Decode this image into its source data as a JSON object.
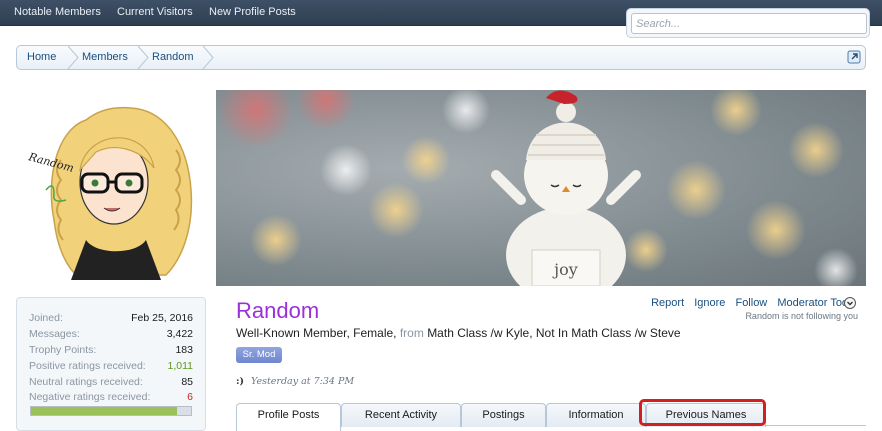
{
  "nav": {
    "items": [
      "Notable Members",
      "Current Visitors",
      "New Profile Posts"
    ]
  },
  "search": {
    "placeholder": "Search..."
  },
  "breadcrumb": [
    "Home",
    "Members",
    "Random"
  ],
  "profile": {
    "name": "Random",
    "title_prefix": "Well-Known Member, Female,",
    "from_label": "from",
    "location": "Math Class /w Kyle, Not In Math Class /w Steve",
    "badge": "Sr. Mod",
    "last_seen": "Yesterday at 7:34 PM",
    "smile": ":)",
    "actions": [
      "Report",
      "Ignore",
      "Follow",
      "Moderator Tools"
    ],
    "follow_status": "Random is not following you",
    "banner_sign": "joy",
    "avatar_signature": "Random"
  },
  "stats": [
    {
      "label": "Joined:",
      "value": "Feb 25, 2016",
      "kind": ""
    },
    {
      "label": "Messages:",
      "value": "3,422",
      "kind": ""
    },
    {
      "label": "Trophy Points:",
      "value": "183",
      "kind": ""
    },
    {
      "label": "Positive ratings received:",
      "value": "1,011",
      "kind": "pos"
    },
    {
      "label": "Neutral ratings received:",
      "value": "85",
      "kind": ""
    },
    {
      "label": "Negative ratings received:",
      "value": "6",
      "kind": "neg"
    }
  ],
  "rating_bar_fraction": 0.91,
  "tabs": [
    "Profile Posts",
    "Recent Activity",
    "Postings",
    "Information",
    "Previous Names"
  ],
  "colors": {
    "name": "#9b30d9",
    "highlight": "#d21f1f",
    "nav": "#34465a"
  }
}
